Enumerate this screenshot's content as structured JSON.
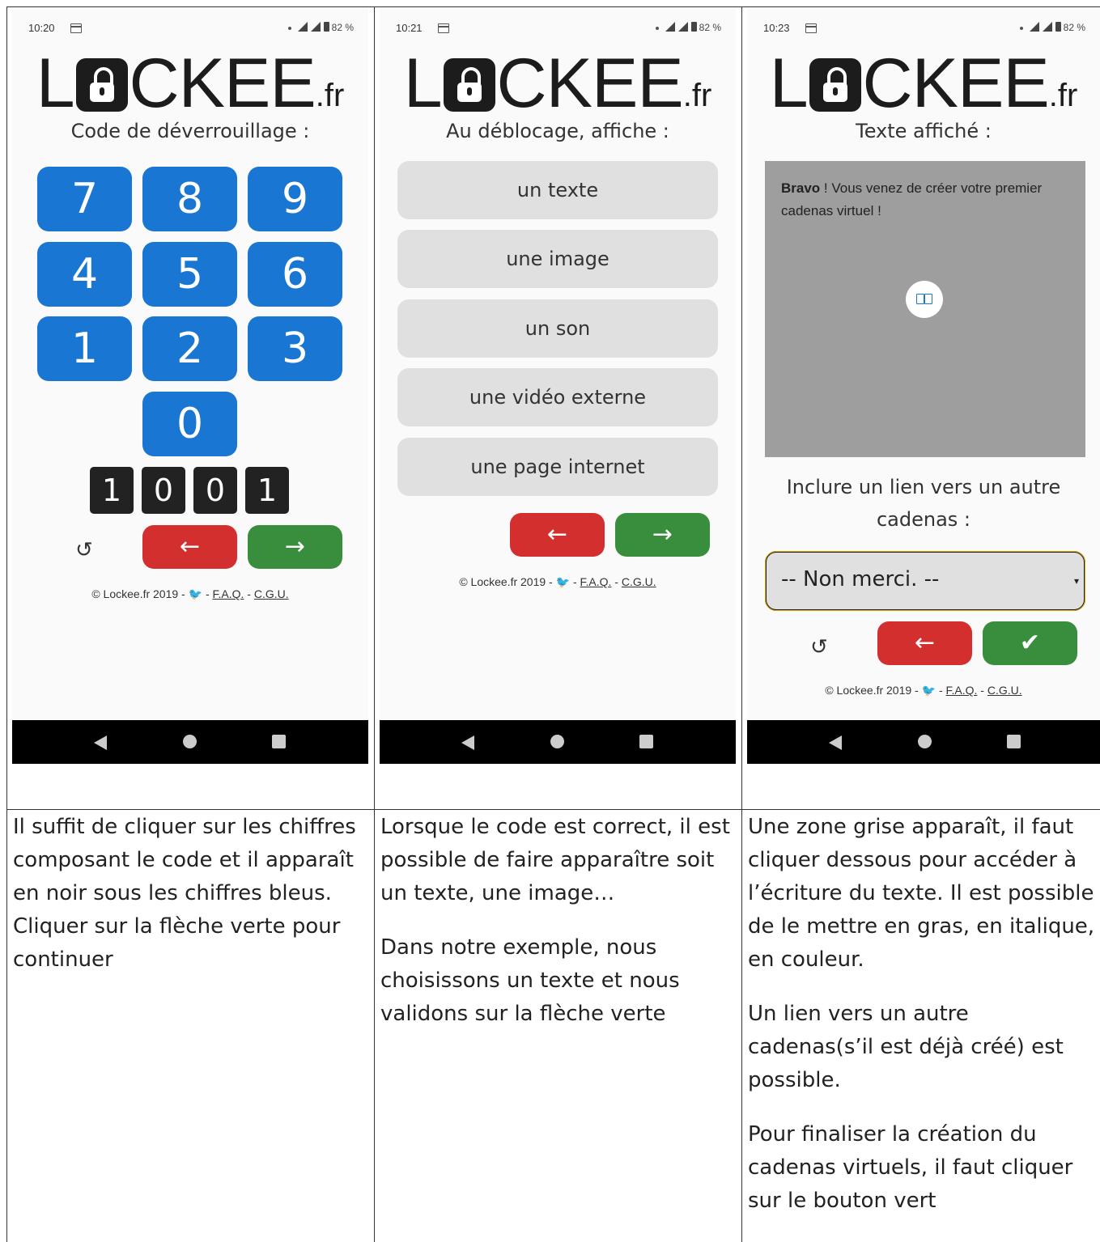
{
  "panels": [
    {
      "status": {
        "time": "10:20",
        "battery": "82 %"
      },
      "logo": {
        "pre": "L",
        "post": "CKEE",
        "suffix": ".fr"
      },
      "heading": "Code de déverrouillage :",
      "keys": [
        "7",
        "8",
        "9",
        "4",
        "5",
        "6",
        "1",
        "2",
        "3",
        "0"
      ],
      "code": [
        "1",
        "0",
        "0",
        "1"
      ],
      "reset": "↺",
      "back": "←",
      "next": "→",
      "footer": {
        "copy": "© Lockee.fr 2019 - ",
        "sep1": " - ",
        "faq": "F.A.Q.",
        "sep2": " - ",
        "cgu": "C.G.U."
      },
      "caption": [
        "Il suffit de cliquer sur les chiffres composant le code et il apparaît en noir sous les chiffres bleus. Cliquer sur la flèche verte pour continuer"
      ]
    },
    {
      "status": {
        "time": "10:21",
        "battery": "82 %"
      },
      "logo": {
        "pre": "L",
        "post": "CKEE",
        "suffix": ".fr"
      },
      "heading": "Au déblocage, affiche :",
      "options": [
        "un texte",
        "une image",
        "un son",
        "une vidéo externe",
        "une page internet"
      ],
      "back": "←",
      "next": "→",
      "footer": {
        "copy": "© Lockee.fr 2019 - ",
        "sep1": " - ",
        "faq": "F.A.Q.",
        "sep2": " - ",
        "cgu": "C.G.U."
      },
      "caption": [
        "Lorsque le code est correct, il est possible de faire apparaître soit un texte, une image…",
        "Dans notre exemple, nous choisissons un texte et nous validons sur la flèche verte"
      ]
    },
    {
      "status": {
        "time": "10:23",
        "battery": "82 %"
      },
      "logo": {
        "pre": "L",
        "post": "CKEE",
        "suffix": ".fr"
      },
      "heading": "Texte affiché :",
      "text_bold": "Bravo",
      "text_rest": " ! Vous venez de créer votre premier cadenas virtuel !",
      "link_heading": "Inclure un lien vers un autre cadenas :",
      "select_value": "-- Non merci. --",
      "reset": "↺",
      "back": "←",
      "validate": "✔",
      "footer": {
        "copy": "© Lockee.fr 2019 - ",
        "sep1": " - ",
        "faq": "F.A.Q.",
        "sep2": " - ",
        "cgu": "C.G.U."
      },
      "caption": [
        "Une zone grise apparaît, il faut cliquer dessous pour accéder à l’écriture du texte. Il est possible de le mettre en gras, en italique, en couleur.",
        "Un lien vers un autre cadenas(s’il est déjà créé) est possible.",
        "Pour finaliser la création du cadenas virtuels, il faut cliquer sur le bouton vert"
      ]
    }
  ],
  "colors": {
    "key_blue": "#1976d2",
    "back_red": "#d32f2f",
    "next_green": "#388e3c",
    "option_gray": "#e0e0e0",
    "text_zone_gray": "#9e9e9e"
  },
  "icons": {
    "twitter": "twitter-icon",
    "reset": "reset-icon",
    "book": "book-icon"
  }
}
